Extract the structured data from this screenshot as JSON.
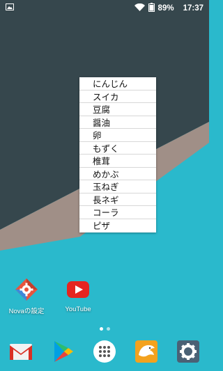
{
  "status_bar": {
    "left_icon": "gallery-notification-icon",
    "wifi_icon": "wifi-icon",
    "battery_percent": "89%",
    "time": "17:37"
  },
  "list": {
    "items": [
      "にんじん",
      "スイカ",
      "豆腐",
      "醤油",
      "卵",
      "もずく",
      "椎茸",
      "めかぶ",
      "玉ねぎ",
      "長ネギ",
      "コーラ",
      "ピザ"
    ]
  },
  "apps": {
    "nova": {
      "label": "Novaの設定",
      "icon": "nova-settings-icon"
    },
    "youtube": {
      "label": "YouTube",
      "icon": "youtube-icon"
    }
  },
  "page_indicator": {
    "pages": 2,
    "active": 0
  },
  "dock": {
    "items": [
      "gmail-icon",
      "play-store-icon",
      "app-drawer-icon",
      "browser-lion-icon",
      "settings-icon"
    ]
  },
  "colors": {
    "wallpaper_dark": "#36474d",
    "wallpaper_taupe": "#a08f87",
    "wallpaper_cyan": "#2ab9cc"
  }
}
